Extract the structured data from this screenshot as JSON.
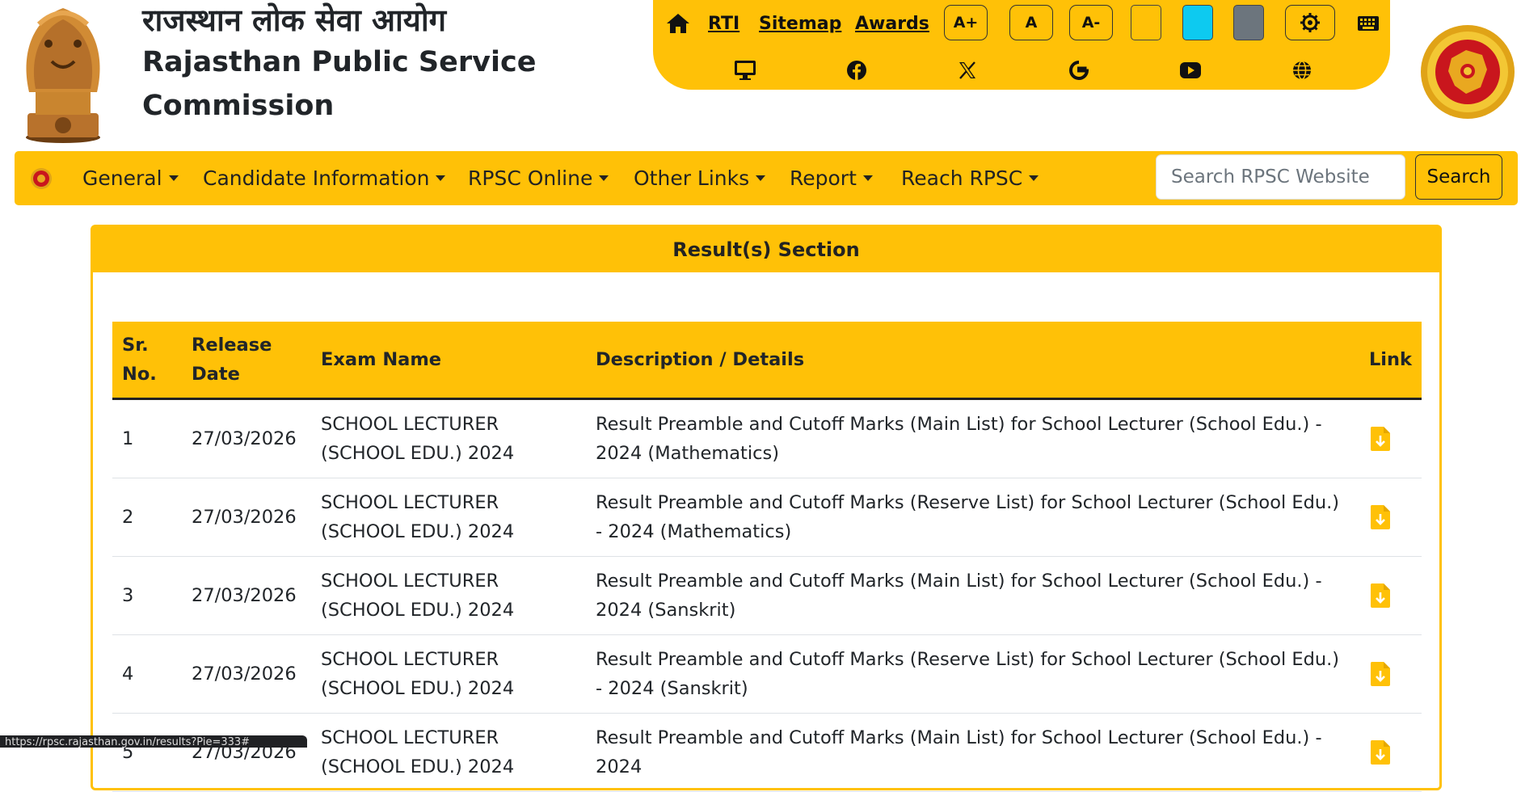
{
  "header": {
    "title_hindi": "राजस्थान लोक सेवा आयोग",
    "title_english_line1": "Rajasthan Public Service",
    "title_english_line2": "Commission"
  },
  "toolbar": {
    "links": [
      "RTI",
      "Sitemap",
      "Awards"
    ],
    "font_buttons": [
      "A+",
      "A",
      "A-"
    ],
    "theme_swatches": [
      "#ffc107",
      "#0dcaf0",
      "#6c757d"
    ],
    "accent": "#ffc107"
  },
  "nav": {
    "items": [
      "General",
      "Candidate Information",
      "RPSC Online",
      "Other Links",
      "Report",
      "Reach RPSC"
    ],
    "search_placeholder": "Search RPSC Website",
    "search_button": "Search"
  },
  "results": {
    "section_title": "Result(s) Section",
    "columns": {
      "sr_no": "Sr. No.",
      "release_date": "Release Date",
      "exam_name": "Exam Name",
      "description": "Description / Details",
      "link": "Link"
    },
    "rows": [
      {
        "sr": "1",
        "date": "27/03/2026",
        "exam": "SCHOOL LECTURER (SCHOOL EDU.) 2024",
        "desc": "Result Preamble and Cutoff Marks (Main List) for School Lecturer (School Edu.) - 2024 (Mathematics)"
      },
      {
        "sr": "2",
        "date": "27/03/2026",
        "exam": "SCHOOL LECTURER (SCHOOL EDU.) 2024",
        "desc": "Result Preamble and Cutoff Marks (Reserve List) for School Lecturer (School Edu.) - 2024 (Mathematics)"
      },
      {
        "sr": "3",
        "date": "27/03/2026",
        "exam": "SCHOOL LECTURER (SCHOOL EDU.) 2024",
        "desc": "Result Preamble and Cutoff Marks (Main List) for School Lecturer (School Edu.) - 2024 (Sanskrit)"
      },
      {
        "sr": "4",
        "date": "27/03/2026",
        "exam": "SCHOOL LECTURER (SCHOOL EDU.) 2024",
        "desc": "Result Preamble and Cutoff Marks (Reserve List) for School Lecturer (School Edu.) - 2024 (Sanskrit)"
      },
      {
        "sr": "5",
        "date": "27/03/2026",
        "exam": "SCHOOL LECTURER (SCHOOL EDU.) 2024",
        "desc": "Result Preamble and Cutoff Marks (Main List) for School Lecturer (School Edu.) - 2024"
      }
    ]
  },
  "status_bar": {
    "url": "https://rpsc.rajasthan.gov.in/results?Pie=333#"
  }
}
